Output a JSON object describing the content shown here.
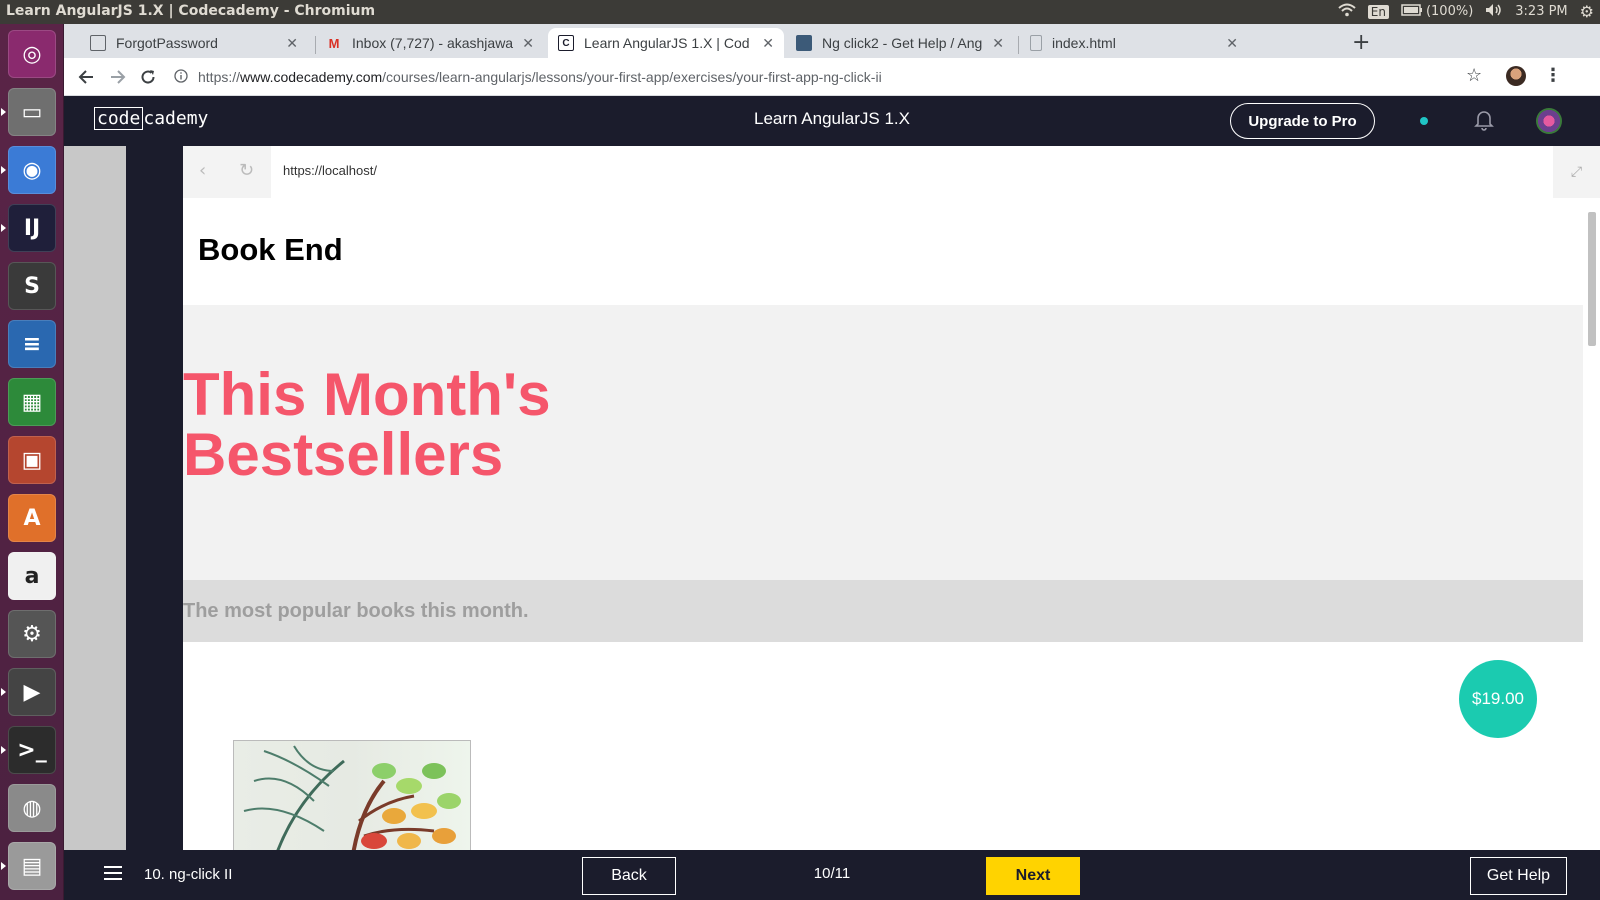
{
  "os_panel": {
    "window_title": "Learn AngularJS 1.X | Codecademy - Chromium",
    "keyboard_layout": "En",
    "battery": "(100%)",
    "clock": "3:23 PM"
  },
  "launcher": {
    "apps": [
      {
        "name": "ubuntu-dash-icon",
        "glyph": "◎",
        "color": "#8a2a6e"
      },
      {
        "name": "files-icon",
        "glyph": "▭",
        "color": "#6f6f6f"
      },
      {
        "name": "chromium-icon",
        "glyph": "◉",
        "color": "#3b7bd6"
      },
      {
        "name": "intellij-icon",
        "glyph": "IJ",
        "color": "#1f1f3a"
      },
      {
        "name": "sublime-icon",
        "glyph": "S",
        "color": "#3a3a3a"
      },
      {
        "name": "writer-icon",
        "glyph": "≡",
        "color": "#2a68b0"
      },
      {
        "name": "calc-icon",
        "glyph": "▦",
        "color": "#2d8a3a"
      },
      {
        "name": "impress-icon",
        "glyph": "▣",
        "color": "#b5462f"
      },
      {
        "name": "software-center-icon",
        "glyph": "A",
        "color": "#e0702a"
      },
      {
        "name": "amazon-icon",
        "glyph": "a",
        "color": "#f0f0f0"
      },
      {
        "name": "system-settings-icon",
        "glyph": "⚙",
        "color": "#555"
      },
      {
        "name": "video-editor-icon",
        "glyph": "▶",
        "color": "#444"
      },
      {
        "name": "terminal-icon",
        "glyph": ">_",
        "color": "#2c2c2c"
      },
      {
        "name": "disk-icon",
        "glyph": "◍",
        "color": "#8a8a8a"
      },
      {
        "name": "drive-icon",
        "glyph": "▤",
        "color": "#9a9a9a"
      }
    ]
  },
  "browser": {
    "tabs": [
      {
        "label": "ForgotPassword",
        "favicon_color": "#5f6368",
        "favicon_glyph": "▢"
      },
      {
        "label": "Inbox (7,727) - akashjawa",
        "favicon_color": "#d93025",
        "favicon_glyph": "M"
      },
      {
        "label": "Learn AngularJS 1.X | Cod",
        "favicon_color": "#1b1c2c",
        "favicon_glyph": "C"
      },
      {
        "label": "Ng click2 - Get Help / Ang",
        "favicon_color": "#3c5a78",
        "favicon_glyph": "▪"
      },
      {
        "label": "index.html",
        "favicon_color": "#9aa0a6",
        "favicon_glyph": "▫"
      }
    ],
    "new_tab_label": "+",
    "url": {
      "scheme": "https://",
      "host": "www.codecademy.com",
      "path": "/courses/learn-angularjs/lessons/your-first-app/exercises/your-first-app-ng-click-ii"
    }
  },
  "codecademy": {
    "logo_box": "code",
    "logo_rest": "cademy",
    "course_title": "Learn AngularJS 1.X",
    "upgrade_label": "Upgrade to Pro"
  },
  "preview": {
    "url": "https://localhost/",
    "site_name": "Book End",
    "hero_title": "This Month's Bestsellers",
    "hero_subtitle": "The most popular books this month.",
    "price": "$19.00"
  },
  "bottom_bar": {
    "lesson": "10. ng-click II",
    "back_label": "Back",
    "progress": "10/11",
    "next_label": "Next",
    "help_label": "Get Help"
  }
}
